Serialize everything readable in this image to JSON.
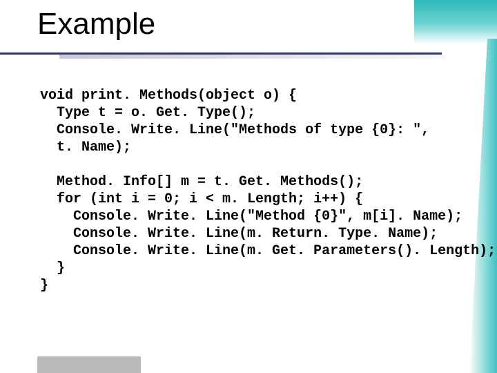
{
  "title": "Example",
  "code": {
    "l1": "void print. Methods(object o) {",
    "l2": "  Type t = o. Get. Type();",
    "l3": "  Console. Write. Line(\"Methods of type {0}: \",",
    "l4": "  t. Name);",
    "l5": "",
    "l6": "  Method. Info[] m = t. Get. Methods();",
    "l7": "  for (int i = 0; i < m. Length; i++) {",
    "l8": "    Console. Write. Line(\"Method {0}\", m[i]. Name);",
    "l9": "    Console. Write. Line(m. Return. Type. Name);",
    "l10": "    Console. Write. Line(m. Get. Parameters(). Length);",
    "l11": "  }",
    "l12": "}"
  }
}
